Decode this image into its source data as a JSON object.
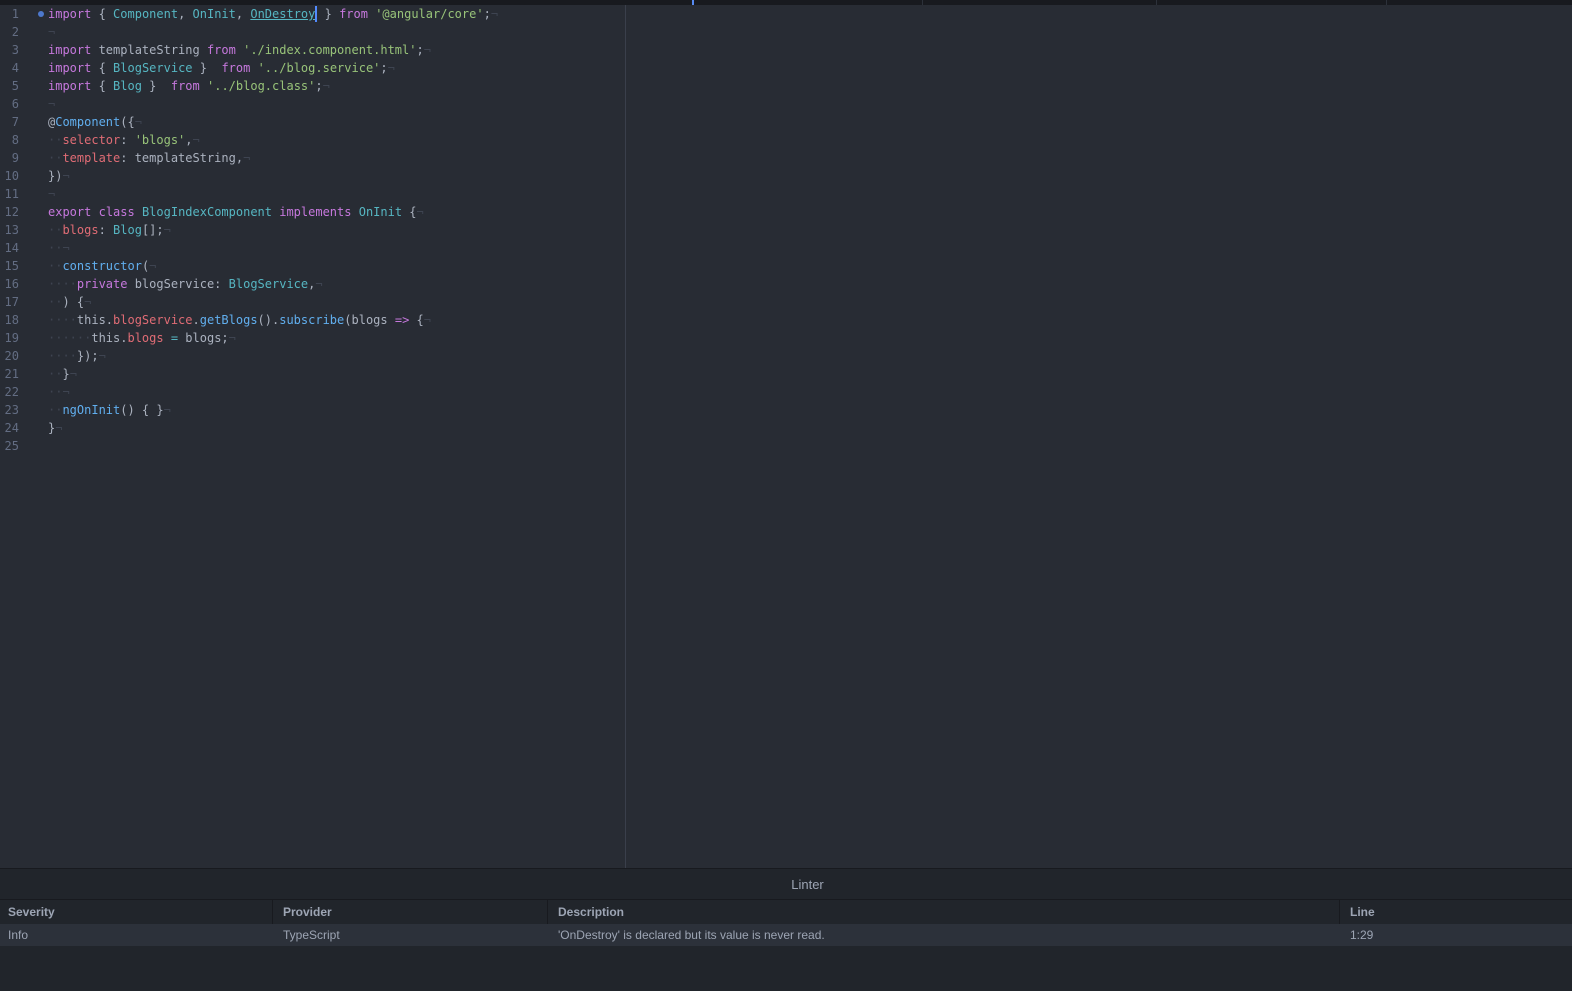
{
  "editor": {
    "lines": [
      {
        "n": "1",
        "modified": true,
        "toks": [
          [
            "kw",
            "import"
          ],
          [
            "plain",
            " { "
          ],
          [
            "type",
            "Component"
          ],
          [
            "plain",
            ", "
          ],
          [
            "type",
            "OnInit"
          ],
          [
            "plain",
            ", "
          ],
          [
            "type ul",
            "OnDestroy"
          ],
          [
            "cursor",
            ""
          ],
          [
            "plain",
            " } "
          ],
          [
            "kw",
            "from"
          ],
          [
            "plain",
            " "
          ],
          [
            "str",
            "'@angular/core'"
          ],
          [
            "plain",
            ";"
          ],
          [
            "inv",
            "¬"
          ]
        ]
      },
      {
        "n": "2",
        "toks": [
          [
            "inv",
            "¬"
          ]
        ]
      },
      {
        "n": "3",
        "toks": [
          [
            "kw",
            "import"
          ],
          [
            "plain",
            " templateString "
          ],
          [
            "kw",
            "from"
          ],
          [
            "plain",
            " "
          ],
          [
            "str",
            "'./index.component.html'"
          ],
          [
            "plain",
            ";"
          ],
          [
            "inv",
            "¬"
          ]
        ]
      },
      {
        "n": "4",
        "toks": [
          [
            "kw",
            "import"
          ],
          [
            "plain",
            " { "
          ],
          [
            "type",
            "BlogService"
          ],
          [
            "plain",
            " }  "
          ],
          [
            "kw",
            "from"
          ],
          [
            "plain",
            " "
          ],
          [
            "str",
            "'../blog.service'"
          ],
          [
            "plain",
            ";"
          ],
          [
            "inv",
            "¬"
          ]
        ]
      },
      {
        "n": "5",
        "toks": [
          [
            "kw",
            "import"
          ],
          [
            "plain",
            " { "
          ],
          [
            "type",
            "Blog"
          ],
          [
            "plain",
            " }  "
          ],
          [
            "kw",
            "from"
          ],
          [
            "plain",
            " "
          ],
          [
            "str",
            "'../blog.class'"
          ],
          [
            "plain",
            ";"
          ],
          [
            "inv",
            "¬"
          ]
        ]
      },
      {
        "n": "6",
        "toks": [
          [
            "inv",
            "¬"
          ]
        ]
      },
      {
        "n": "7",
        "toks": [
          [
            "plain",
            "@"
          ],
          [
            "fn",
            "Component"
          ],
          [
            "plain",
            "({"
          ],
          [
            "inv",
            "¬"
          ]
        ]
      },
      {
        "n": "8",
        "toks": [
          [
            "inv",
            "··"
          ],
          [
            "prop",
            "selector"
          ],
          [
            "plain",
            ": "
          ],
          [
            "str",
            "'blogs'"
          ],
          [
            "plain",
            ","
          ],
          [
            "inv",
            "¬"
          ]
        ]
      },
      {
        "n": "9",
        "toks": [
          [
            "inv",
            "··"
          ],
          [
            "prop",
            "template"
          ],
          [
            "plain",
            ": templateString,"
          ],
          [
            "inv",
            "¬"
          ]
        ]
      },
      {
        "n": "10",
        "toks": [
          [
            "plain",
            "})"
          ],
          [
            "inv",
            "¬"
          ]
        ]
      },
      {
        "n": "11",
        "toks": [
          [
            "inv",
            "¬"
          ]
        ]
      },
      {
        "n": "12",
        "toks": [
          [
            "kw",
            "export"
          ],
          [
            "plain",
            " "
          ],
          [
            "kw",
            "class"
          ],
          [
            "plain",
            " "
          ],
          [
            "type",
            "BlogIndexComponent"
          ],
          [
            "plain",
            " "
          ],
          [
            "kw",
            "implements"
          ],
          [
            "plain",
            " "
          ],
          [
            "type",
            "OnInit"
          ],
          [
            "plain",
            " {"
          ],
          [
            "inv",
            "¬"
          ]
        ]
      },
      {
        "n": "13",
        "toks": [
          [
            "inv",
            "··"
          ],
          [
            "prop",
            "blogs"
          ],
          [
            "plain",
            ": "
          ],
          [
            "type",
            "Blog"
          ],
          [
            "plain",
            "[];"
          ],
          [
            "inv",
            "¬"
          ]
        ]
      },
      {
        "n": "14",
        "toks": [
          [
            "inv",
            "··¬"
          ]
        ]
      },
      {
        "n": "15",
        "toks": [
          [
            "inv",
            "··"
          ],
          [
            "fn",
            "constructor"
          ],
          [
            "plain",
            "("
          ],
          [
            "inv",
            "¬"
          ]
        ]
      },
      {
        "n": "16",
        "toks": [
          [
            "inv",
            "····"
          ],
          [
            "kw",
            "private"
          ],
          [
            "plain",
            " blogService: "
          ],
          [
            "type",
            "BlogService"
          ],
          [
            "plain",
            ","
          ],
          [
            "inv",
            "¬"
          ]
        ]
      },
      {
        "n": "17",
        "toks": [
          [
            "inv",
            "··"
          ],
          [
            "plain",
            ") {"
          ],
          [
            "inv",
            "¬"
          ]
        ]
      },
      {
        "n": "18",
        "toks": [
          [
            "inv",
            "····"
          ],
          [
            "plain",
            "this."
          ],
          [
            "prop",
            "blogService"
          ],
          [
            "plain",
            "."
          ],
          [
            "fn",
            "getBlogs"
          ],
          [
            "plain",
            "()."
          ],
          [
            "fn",
            "subscribe"
          ],
          [
            "plain",
            "(blogs "
          ],
          [
            "kw",
            "=>"
          ],
          [
            "plain",
            " {"
          ],
          [
            "inv",
            "¬"
          ]
        ]
      },
      {
        "n": "19",
        "toks": [
          [
            "inv",
            "······"
          ],
          [
            "plain",
            "this."
          ],
          [
            "prop",
            "blogs"
          ],
          [
            "plain",
            " "
          ],
          [
            "type",
            "="
          ],
          [
            "plain",
            " blogs;"
          ],
          [
            "inv",
            "¬"
          ]
        ]
      },
      {
        "n": "20",
        "toks": [
          [
            "inv",
            "····"
          ],
          [
            "plain",
            "});"
          ],
          [
            "inv",
            "¬"
          ]
        ]
      },
      {
        "n": "21",
        "toks": [
          [
            "inv",
            "··"
          ],
          [
            "plain",
            "}"
          ],
          [
            "inv",
            "¬"
          ]
        ]
      },
      {
        "n": "22",
        "toks": [
          [
            "inv",
            "··¬"
          ]
        ]
      },
      {
        "n": "23",
        "toks": [
          [
            "inv",
            "··"
          ],
          [
            "fn",
            "ngOnInit"
          ],
          [
            "plain",
            "() { }"
          ],
          [
            "inv",
            "¬"
          ]
        ]
      },
      {
        "n": "24",
        "toks": [
          [
            "plain",
            "}"
          ],
          [
            "inv",
            "¬"
          ]
        ]
      },
      {
        "n": "25",
        "toks": []
      }
    ]
  },
  "linter": {
    "title": "Linter",
    "headers": {
      "severity": "Severity",
      "provider": "Provider",
      "description": "Description",
      "line": "Line"
    },
    "rows": [
      {
        "severity": "Info",
        "provider": "TypeScript",
        "description": "'OnDestroy' is declared but its value is never read.",
        "line": "1:29"
      }
    ]
  }
}
